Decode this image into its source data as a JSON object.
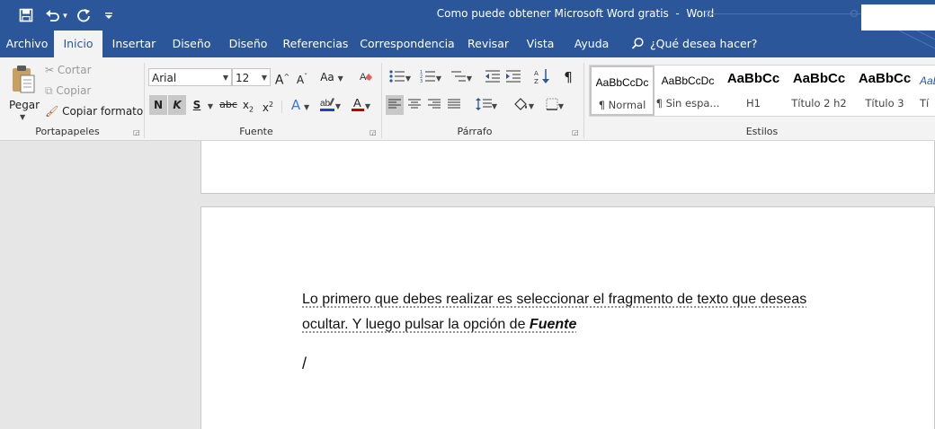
{
  "titlebar": {
    "document_title": "Como puede obtener Microsoft Word gratis",
    "separator": "-",
    "app_name": "Word",
    "qat": {
      "save_icon": "save-icon",
      "undo_icon": "undo-icon",
      "redo_icon": "redo-icon",
      "customize_icon": "customize-qat-icon"
    }
  },
  "tabs": [
    {
      "label": "Archivo"
    },
    {
      "label": "Inicio",
      "active": true
    },
    {
      "label": "Insertar"
    },
    {
      "label": "Diseño"
    },
    {
      "label": "Diseño"
    },
    {
      "label": "Referencias"
    },
    {
      "label": "Correspondencia"
    },
    {
      "label": "Revisar"
    },
    {
      "label": "Vista"
    },
    {
      "label": "Ayuda"
    }
  ],
  "tell_me": "¿Qué desea hacer?",
  "clipboard": {
    "paste": "Pegar",
    "cut": "Cortar",
    "copy": "Copiar",
    "format_painter": "Copiar formato",
    "group_label": "Portapapeles"
  },
  "font": {
    "family": "Arial",
    "size": "12",
    "group_label": "Fuente",
    "change_case": "Aa",
    "bold": "N",
    "italic": "K",
    "underline": "S",
    "strikethrough": "abc",
    "subscript": "x",
    "superscript": "x",
    "grow": "A",
    "shrink": "A",
    "text_effects": "A",
    "font_color": "A"
  },
  "paragraph": {
    "group_label": "Párrafo",
    "show_marks": "¶"
  },
  "styles": {
    "group_label": "Estilos",
    "items": [
      {
        "preview": "AaBbCcDc",
        "name": "¶ Normal",
        "selected": true
      },
      {
        "preview": "AaBbCcDc",
        "name": "¶ Sin espa..."
      },
      {
        "preview": "AaBbCc",
        "name": "H1"
      },
      {
        "preview": "AaBbCc",
        "name": "Título 2 h2"
      },
      {
        "preview": "AaBbCc",
        "name": "Título 3"
      },
      {
        "preview": "AaBl",
        "name": "Tí"
      }
    ]
  },
  "document": {
    "line1": "Lo primero que debes realizar es seleccionar el fragmento de texto que deseas",
    "line2_prefix": "ocultar. Y luego pulsar la opción de ",
    "line2_emphasis": "Fuente",
    "cursor_char": "/"
  },
  "colors": {
    "title_bar": "#2b579a",
    "ribbon_bg": "#f3f3f3",
    "canvas_bg": "#e6e6e6",
    "highlight_color": "#1f3fcf",
    "font_color_bar": "#c00000"
  }
}
